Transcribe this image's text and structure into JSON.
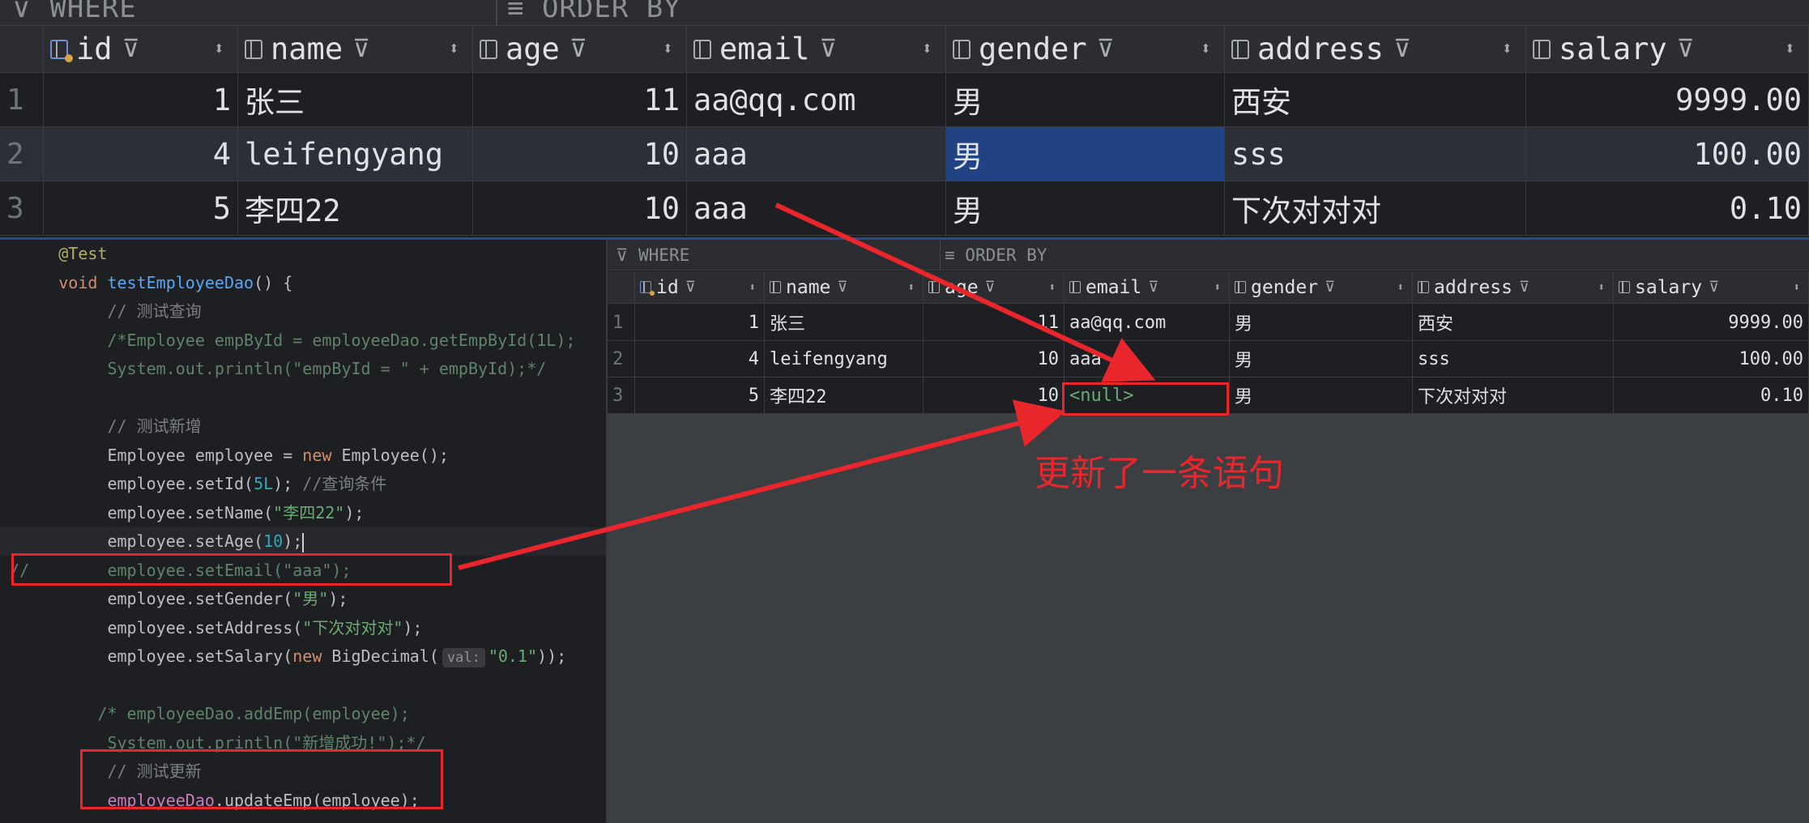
{
  "filter_bar": {
    "where_label": "WHERE",
    "order_by_label": "ORDER BY"
  },
  "columns": [
    {
      "name": "id",
      "key": true
    },
    {
      "name": "name",
      "key": false
    },
    {
      "name": "age",
      "key": false
    },
    {
      "name": "email",
      "key": false
    },
    {
      "name": "gender",
      "key": false
    },
    {
      "name": "address",
      "key": false
    },
    {
      "name": "salary",
      "key": false
    }
  ],
  "top_table": {
    "rows": [
      {
        "rownum": "1",
        "id": "1",
        "name": "张三",
        "age": "11",
        "email": "aa@qq.com",
        "gender": "男",
        "address": "西安",
        "salary": "9999.00"
      },
      {
        "rownum": "2",
        "id": "4",
        "name": "leifengyang",
        "age": "10",
        "email": "aaa",
        "gender": "男",
        "address": "sss",
        "salary": "100.00"
      },
      {
        "rownum": "3",
        "id": "5",
        "name": "李四22",
        "age": "10",
        "email": "aaa",
        "gender": "男",
        "address": "下次对对对",
        "salary": "0.10"
      }
    ]
  },
  "small_table": {
    "rows": [
      {
        "rownum": "1",
        "id": "1",
        "name": "张三",
        "age": "11",
        "email": "aa@qq.com",
        "gender": "男",
        "address": "西安",
        "salary": "9999.00"
      },
      {
        "rownum": "2",
        "id": "4",
        "name": "leifengyang",
        "age": "10",
        "email": "aaa",
        "gender": "男",
        "address": "sss",
        "salary": "100.00"
      },
      {
        "rownum": "3",
        "id": "5",
        "name": "李四22",
        "age": "10",
        "email": "<null>",
        "gender": "男",
        "address": "下次对对对",
        "salary": "0.10"
      }
    ]
  },
  "code": {
    "l_ann": "@Test",
    "l_sig_kw": "void",
    "l_sig_fn": "testEmployeeDao",
    "l_sig_end": "() {",
    "l_c1": "// 测试查询",
    "l_c2": "/*Employee empById = employeeDao.getEmpById(1L);",
    "l_c3": "System.out.println(\"empById = \" + empById);*/",
    "l_c4": "// 测试新增",
    "l_n1": "Employee employee = ",
    "l_n_kw": "new",
    "l_n2": " Employee();",
    "l_id1": "employee.setId(",
    "l_id_num": "5L",
    "l_id2": "); ",
    "l_id_cmt": "//查询条件",
    "l_name1": "employee.setName(",
    "l_name_str": "\"李四22\"",
    "l_name2": ");",
    "l_age1": "employee.setAge(",
    "l_age_num": "10",
    "l_age2": ");",
    "l_email": "//        employee.setEmail(\"aaa\");",
    "l_gender1": "employee.setGender(",
    "l_gender_str": "\"男\"",
    "l_gender2": ");",
    "l_addr1": "employee.setAddress(",
    "l_addr_str": "\"下次对对对\"",
    "l_addr2": ");",
    "l_sal1": "employee.setSalary(",
    "l_sal_kw": "new",
    "l_sal2": " BigDecimal(",
    "l_sal_hint": "val:",
    "l_sal_str": "\"0.1\"",
    "l_sal3": "));",
    "l_add1": "/* employeeDao.addEmp(employee);",
    "l_add2": "System.out.println(\"新增成功!\");*/",
    "l_upd_cmt": "// 测试更新",
    "l_upd_fld": "employeeDao",
    "l_upd_rest": ".updateEmp(employee);"
  },
  "annotation": {
    "text": "更新了一条语句",
    "color": "#e8262c"
  }
}
